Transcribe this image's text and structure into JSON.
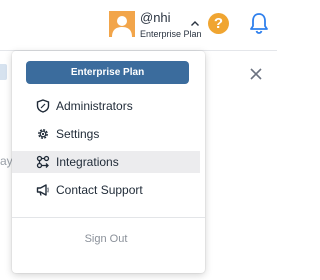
{
  "user": {
    "handle": "@nhi",
    "plan": "Enterprise Plan"
  },
  "header": {
    "help_label": "?"
  },
  "background": {
    "partial_text": "ay"
  },
  "menu": {
    "plan_button": "Enterprise Plan",
    "items": [
      {
        "label": "Administrators",
        "icon": "shield-icon"
      },
      {
        "label": "Settings",
        "icon": "gear-icon"
      },
      {
        "label": "Integrations",
        "icon": "integrations-icon",
        "active": true
      },
      {
        "label": "Contact Support",
        "icon": "megaphone-icon"
      }
    ],
    "sign_out": "Sign Out"
  },
  "colors": {
    "accent": "#3b6c9d",
    "help": "#f0a531",
    "bell": "#2f80ed",
    "avatar": "#f2a54a",
    "active_item_bg": "#ececee"
  }
}
